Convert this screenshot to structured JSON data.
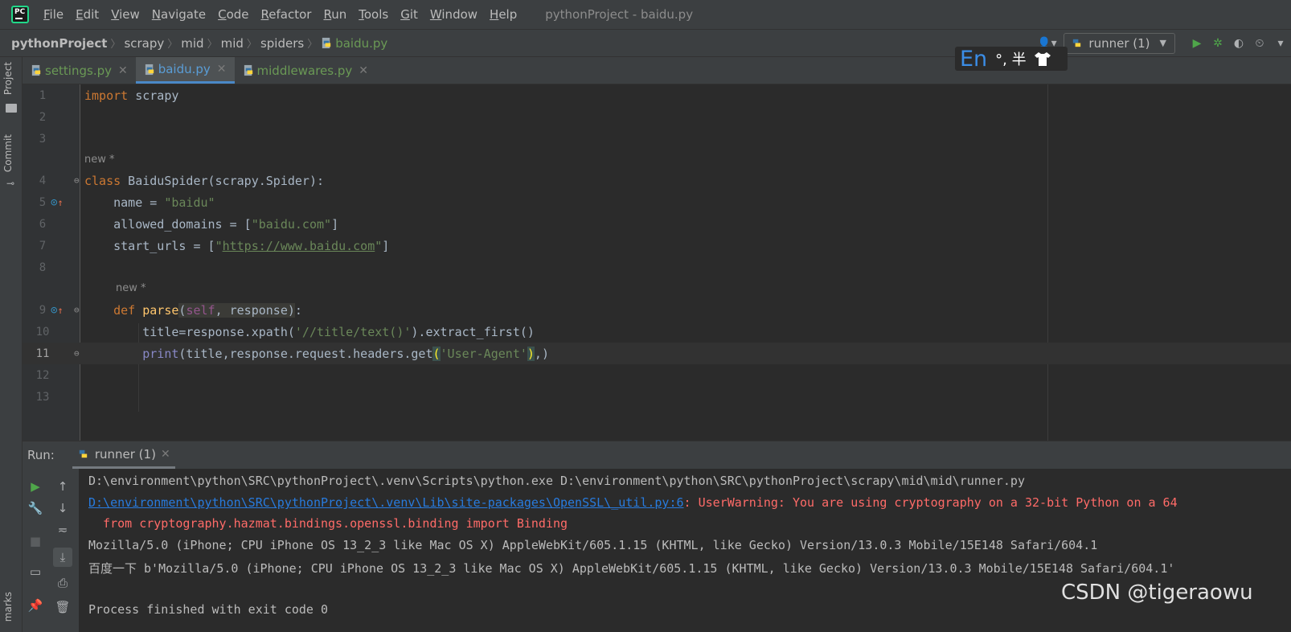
{
  "menu": {
    "items": [
      {
        "label": "File",
        "mnemonic": "F",
        "rest": "ile"
      },
      {
        "label": "Edit",
        "mnemonic": "E",
        "rest": "dit"
      },
      {
        "label": "View",
        "mnemonic": "V",
        "rest": "iew"
      },
      {
        "label": "Navigate",
        "mnemonic": "N",
        "rest": "avigate"
      },
      {
        "label": "Code",
        "mnemonic": "C",
        "rest": "ode"
      },
      {
        "label": "Refactor",
        "mnemonic": "R",
        "rest": "efactor"
      },
      {
        "label": "Run",
        "mnemonic": "R",
        "rest": "un"
      },
      {
        "label": "Tools",
        "mnemonic": "T",
        "rest": "ools"
      },
      {
        "label": "Git",
        "mnemonic": "G",
        "rest": "it"
      },
      {
        "label": "Window",
        "mnemonic": "W",
        "rest": "indow"
      },
      {
        "label": "Help",
        "mnemonic": "H",
        "rest": "elp"
      }
    ],
    "window_title": "pythonProject - baidu.py",
    "app_logo_text": "PC"
  },
  "breadcrumb": {
    "project": "pythonProject",
    "parts": [
      "scrapy",
      "mid",
      "mid",
      "spiders"
    ],
    "file": "baidu.py"
  },
  "run_config": {
    "label": "runner (1)"
  },
  "ime": {
    "lang": "En",
    "symbols": "°, 半"
  },
  "side_tabs": {
    "project": "Project",
    "commit": "Commit",
    "bookmarks": "marks"
  },
  "tabs": [
    {
      "label": "settings.py",
      "active": false
    },
    {
      "label": "baidu.py",
      "active": true
    },
    {
      "label": "middlewares.py",
      "active": false
    }
  ],
  "editor": {
    "hint_new": "new *",
    "line_numbers": [
      "1",
      "2",
      "3",
      "4",
      "5",
      "6",
      "7",
      "8",
      "9",
      "10",
      "11",
      "12",
      "13"
    ],
    "code": {
      "l1_kw": "import",
      "l1_rest": " scrapy",
      "l4_kw": "class",
      "l4_rest": " BaiduSpider(scrapy.Spider):",
      "l5_a": "    name = ",
      "l5_str": "\"baidu\"",
      "l6_a": "    allowed_domains = [",
      "l6_str": "\"baidu.com\"",
      "l6_b": "]",
      "l7_a": "    start_urls = [",
      "l7_q1": "\"",
      "l7_url": "https://www.baidu.com",
      "l7_q2": "\"",
      "l7_b": "]",
      "l9_kw": "    def",
      "l9_fn": " parse",
      "l9_p1": "(",
      "l9_self": "self",
      "l9_p2": ", response)",
      "l9_end": ":",
      "l10_a": "        title=response.xpath(",
      "l10_str": "'//title/text()'",
      "l10_b": ").extract_first()",
      "l11_indent": "        ",
      "l11_print": "print",
      "l11_a": "(title,response.request.headers.get",
      "l11_po": "(",
      "l11_str": "'User-Agent'",
      "l11_pc": ")",
      "l11_b": ",)"
    }
  },
  "run": {
    "label": "Run:",
    "tab": "runner (1)",
    "lines": {
      "cmd": "D:\\environment\\python\\SRC\\pythonProject\\.venv\\Scripts\\python.exe D:\\environment\\python\\SRC\\pythonProject\\scrapy\\mid\\mid\\runner.py",
      "warn_link": "D:\\environment\\python\\SRC\\pythonProject\\.venv\\Lib\\site-packages\\OpenSSL\\_util.py:6",
      "warn_text": ": UserWarning: You are using cryptography on a 32-bit Python on a 64",
      "import_line": "  from cryptography.hazmat.bindings.openssl.binding import Binding",
      "ua_line": "Mozilla/5.0 (iPhone; CPU iPhone OS 13_2_3 like Mac OS X) AppleWebKit/605.1.15 (KHTML, like Gecko) Version/13.0.3 Mobile/15E148 Safari/604.1",
      "result_line": "百度一下 b'Mozilla/5.0 (iPhone; CPU iPhone OS 13_2_3 like Mac OS X) AppleWebKit/605.1.15 (KHTML, like Gecko) Version/13.0.3 Mobile/15E148 Safari/604.1'",
      "exit_line": "Process finished with exit code 0"
    }
  },
  "watermark": "CSDN @tigeraowu",
  "colors": {
    "accent_tab": "#4a88c7",
    "keyword": "#cc7832",
    "string": "#6a8759",
    "error": "#ff6b68",
    "run_green": "#4fa64a"
  }
}
